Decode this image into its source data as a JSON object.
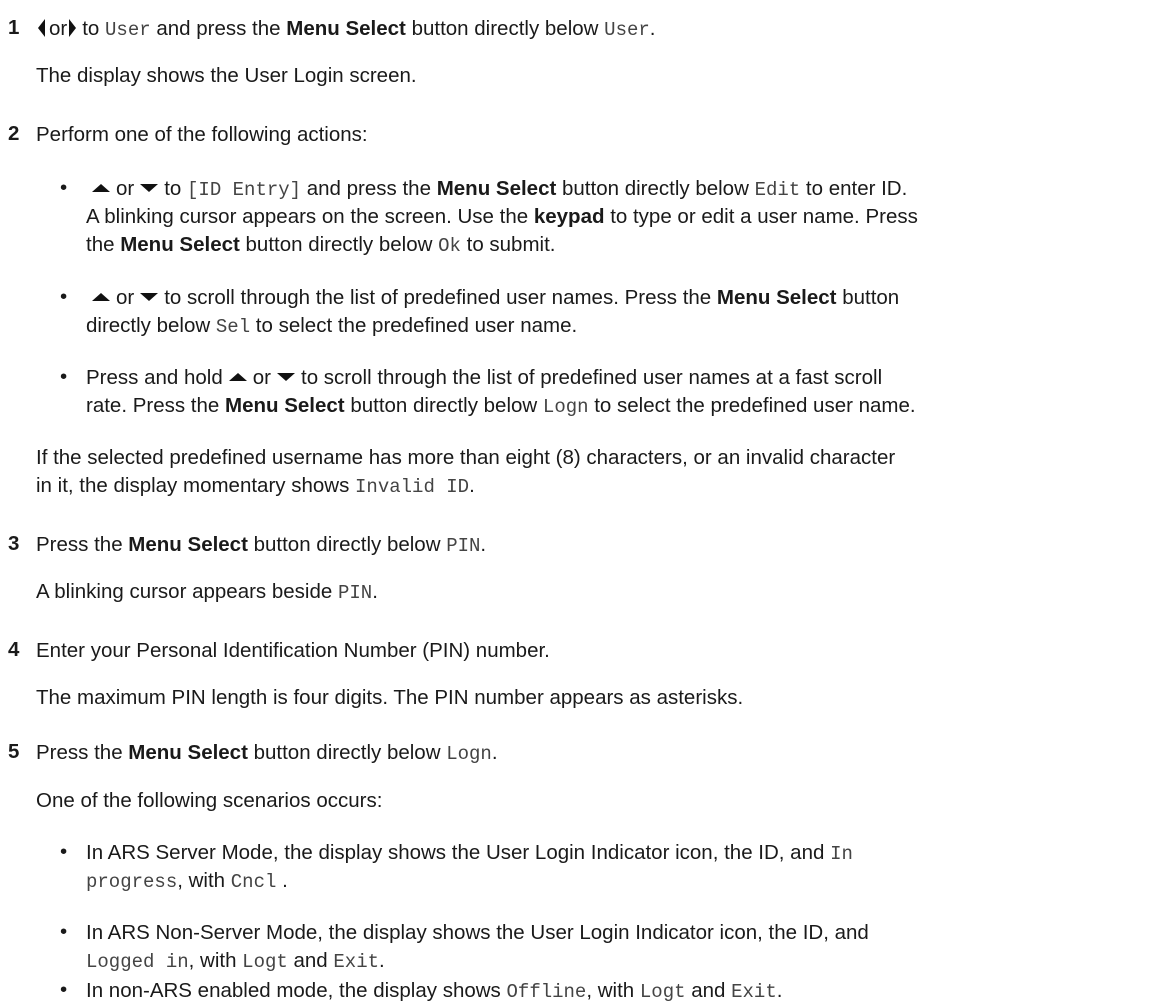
{
  "steps": [
    {
      "number": "1",
      "line": {
        "a": "or",
        "b": "to ",
        "c": "User",
        "d": " and press the ",
        "e": "Menu Select",
        "f": " button directly below ",
        "g": "User",
        "h": "."
      },
      "result": "The display shows the User Login screen."
    },
    {
      "number": "2",
      "intro": "Perform one of the following actions:",
      "options": [
        {
          "l1": {
            "a": "or",
            "b": "to ",
            "c": "[ID Entry]",
            "d": " and press the ",
            "e": "Menu Select",
            "f": " button directly below ",
            "g": "Edit",
            "h": " to enter ID."
          },
          "l2": {
            "a": "A blinking cursor appears on the screen. Use the ",
            "b": "keypad",
            "c": " to type or edit a user name. Press"
          },
          "l3": {
            "a": "the ",
            "b": "Menu Select",
            "c": " button directly below ",
            "d": "Ok",
            "e": " to submit."
          }
        },
        {
          "l1": {
            "a": "or",
            "b": "to scroll through the list of predefined user names. Press the ",
            "c": "Menu Select",
            "d": " button"
          },
          "l2": {
            "a": "directly below ",
            "b": "Sel",
            "c": " to select the predefined user name."
          }
        },
        {
          "l1": {
            "a": "Press and hold",
            "b": "or",
            "c": "to scroll through the list of predefined user names at a fast scroll"
          },
          "l2": {
            "a": "rate. Press the ",
            "b": "Menu Select",
            "c": " button directly below ",
            "d": "Logn",
            "e": " to select the predefined user name."
          }
        }
      ],
      "note": {
        "l1": "If the selected predefined username has more than eight (8) characters, or an invalid character",
        "l2a": "in it, the display momentary shows ",
        "l2b": "Invalid ID",
        "l2c": "."
      }
    },
    {
      "number": "3",
      "line": {
        "a": "Press the ",
        "b": "Menu Select",
        "c": " button directly below ",
        "d": "PIN",
        "e": "."
      },
      "result": {
        "a": "A blinking cursor appears beside ",
        "b": "PIN",
        "c": "."
      }
    },
    {
      "number": "4",
      "line": "Enter your Personal Identification Number (PIN) number.",
      "result": "The maximum PIN length is four digits. The PIN number appears as asterisks."
    },
    {
      "number": "5",
      "line": {
        "a": "Press the ",
        "b": "Menu Select",
        "c": " button directly below ",
        "d": "Logn",
        "e": "."
      },
      "result": "One of the following scenarios occurs:",
      "scenarios": [
        {
          "l1a": "In ARS Server Mode, the display shows the User Login Indicator icon, the ID, and ",
          "l1b": "In",
          "l2a": "progress",
          "l2b": ", with ",
          "l2c": "Cncl",
          "l2d": " ."
        },
        {
          "l1": "In ARS Non-Server Mode, the display shows the User Login Indicator icon, the ID, and",
          "l2a": "Logged in",
          "l2b": ", with ",
          "l2c": "Logt",
          "l2d": " and ",
          "l2e": "Exit",
          "l2f": "."
        },
        {
          "l1a": "In non-ARS enabled mode, the display shows ",
          "l1b": "Offline",
          "l1c": ", with ",
          "l1d": "Logt",
          "l1e": " and ",
          "l1f": "Exit",
          "l1g": "."
        }
      ]
    }
  ],
  "bullet_char": "•"
}
